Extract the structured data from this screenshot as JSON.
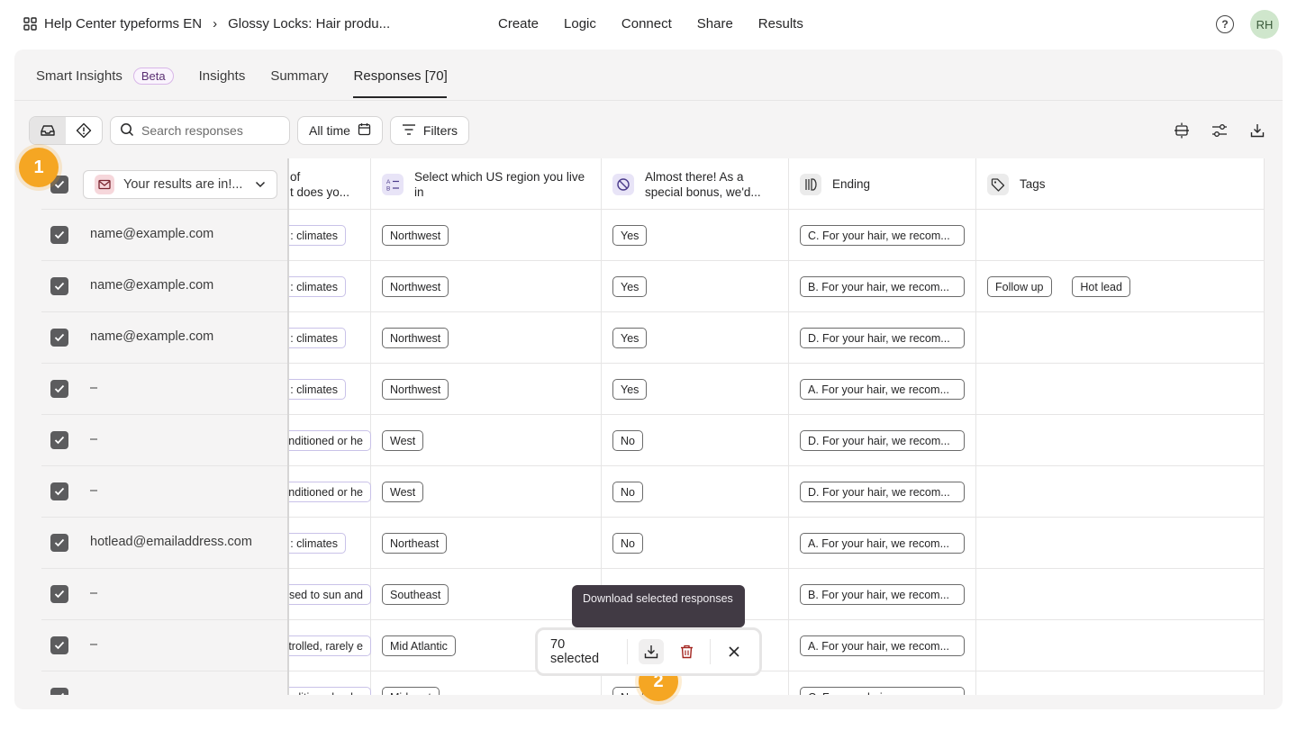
{
  "header": {
    "breadcrumb_workspace": "Help Center typeforms EN",
    "breadcrumb_sep": "›",
    "breadcrumb_form": "Glossy Locks: Hair produ...",
    "nav": [
      "Create",
      "Logic",
      "Connect",
      "Share",
      "Results"
    ],
    "help": "?",
    "avatar": "RH"
  },
  "subtabs": {
    "smart_insights": "Smart Insights",
    "beta": "Beta",
    "insights": "Insights",
    "summary": "Summary",
    "responses": "Responses [70]"
  },
  "toolbar": {
    "search_placeholder": "Search responses",
    "date_filter": "All time",
    "filters": "Filters"
  },
  "table": {
    "email_header": "Your results are in!...",
    "columns": [
      {
        "label": "of\nt does yo..."
      },
      {
        "label": "Select which US region you live in"
      },
      {
        "label": "Almost there! As a special bonus, we'd..."
      },
      {
        "label": "Ending"
      },
      {
        "label": "Tags"
      }
    ],
    "rows": [
      {
        "email": "name@example.com",
        "climate": ": climates",
        "region": "Northwest",
        "bonus": "Yes",
        "ending": "C. For your hair, we recom...",
        "tags": []
      },
      {
        "email": "name@example.com",
        "climate": ": climates",
        "region": "Northwest",
        "bonus": "Yes",
        "ending": "B. For your hair, we recom...",
        "tags": [
          "Follow up",
          "Hot lead"
        ]
      },
      {
        "email": "name@example.com",
        "climate": ": climates",
        "region": "Northwest",
        "bonus": "Yes",
        "ending": "D. For your hair, we recom...",
        "tags": []
      },
      {
        "email": "–",
        "climate": ": climates",
        "region": "Northwest",
        "bonus": "Yes",
        "ending": "A. For your hair, we recom...",
        "tags": []
      },
      {
        "email": "–",
        "climate": "onditioned or he",
        "region": "West",
        "bonus": "No",
        "ending": "D. For your hair, we recom...",
        "tags": []
      },
      {
        "email": "–",
        "climate": "onditioned or he",
        "region": "West",
        "bonus": "No",
        "ending": "D. For your hair, we recom...",
        "tags": []
      },
      {
        "email": "hotlead@emailaddress.com",
        "climate": ": climates",
        "region": "Northeast",
        "bonus": "No",
        "ending": "A. For your hair, we recom...",
        "tags": []
      },
      {
        "email": "–",
        "climate": "osed to sun and",
        "region": "Southeast",
        "bonus": "",
        "ending": "B. For your hair, we recom...",
        "tags": []
      },
      {
        "email": "–",
        "climate": "ntrolled, rarely e",
        "region": "Mid Atlantic",
        "bonus": "",
        "ending": "A. For your hair, we recom...",
        "tags": []
      },
      {
        "email": "",
        "climate": "onditioned or he",
        "region": "Midwest",
        "bonus": "No",
        "ending": "C. For your hair, we recom...",
        "tags": []
      }
    ]
  },
  "selection_bar": {
    "count": "70 selected",
    "tooltip": "Download selected responses"
  },
  "badges": [
    "1",
    "2"
  ],
  "colors": {
    "accent_badge": "#f5a623",
    "checkbox": "#5c5c5e",
    "tooltip_bg": "#413a44",
    "beta_border": "#d8b7e8"
  }
}
